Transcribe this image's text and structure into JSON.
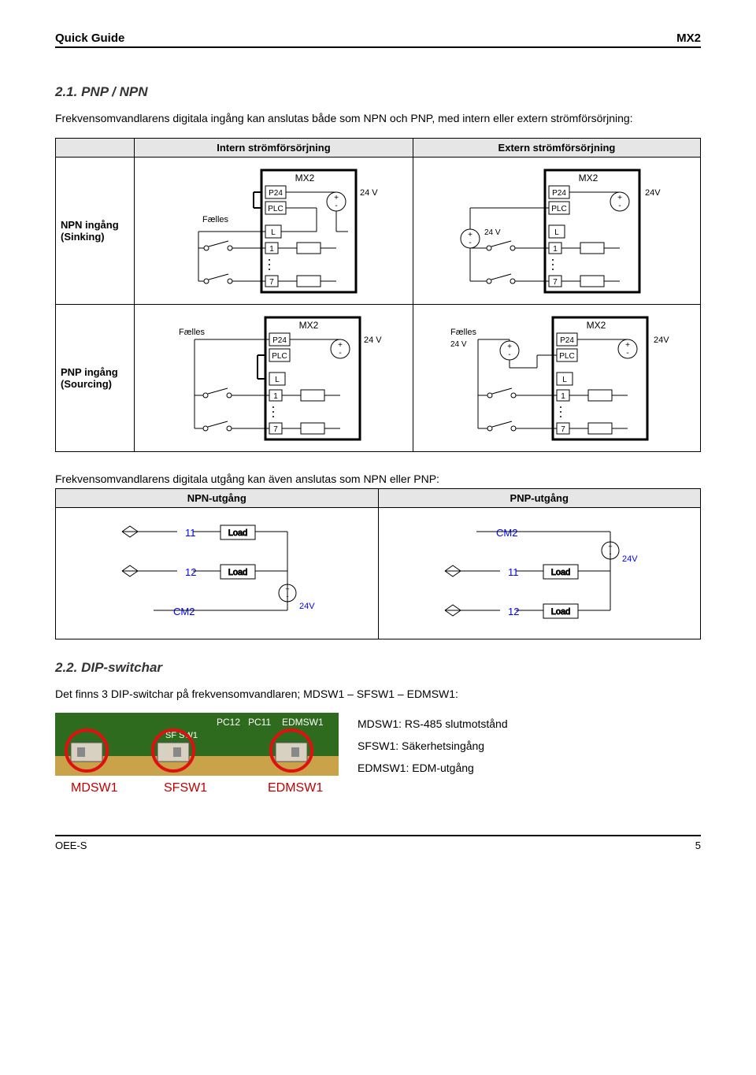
{
  "header": {
    "left": "Quick Guide",
    "right": "MX2"
  },
  "section21": {
    "heading": "2.1.  PNP / NPN",
    "intro": "Frekvensomvandlarens digitala ingång kan anslutas både som NPN och PNP, med intern eller extern strömförsörjning:",
    "cols": {
      "internal": "Intern strömförsörjning",
      "external": "Extern strömförsörjning"
    },
    "rows": {
      "npn": {
        "label1": "NPN ingång",
        "label2": "(Sinking)"
      },
      "pnp": {
        "label1": "PNP ingång",
        "label2": "(Sourcing)"
      }
    },
    "output_caption": "Frekvensomvandlarens digitala utgång kan även anslutas som NPN eller PNP:",
    "output_cols": {
      "npn": "NPN-utgång",
      "pnp": "PNP-utgång"
    }
  },
  "diagram_labels": {
    "mx2": "MX2",
    "p24": "P24",
    "plc": "PLC",
    "l": "L",
    "v24": "24 V",
    "v24v": "24V",
    "n1": "1",
    "n7": "7",
    "faelles": "Fælles",
    "cm2": "CM2",
    "n11": "11",
    "n12": "12",
    "load": "Load"
  },
  "section22": {
    "heading": "2.2.  DIP-switchar",
    "intro": "Det finns 3 DIP-switchar på frekvensomvandlaren; MDSW1 – SFSW1 – EDMSW1:",
    "items": {
      "mdsw1": "MDSW1: RS-485 slutmotstånd",
      "sfsw1": "SFSW1: Säkerhetsingång",
      "edmsw1": "EDMSW1: EDM-utgång"
    },
    "labels": {
      "a": "MDSW1",
      "b": "SFSW1",
      "c": "EDMSW1"
    },
    "pcb_silk": {
      "a": "PC12",
      "b": "PC11",
      "c": "EDMSW1",
      "d": "SF SW1"
    }
  },
  "footer": {
    "left": "OEE-S",
    "right": "5"
  }
}
